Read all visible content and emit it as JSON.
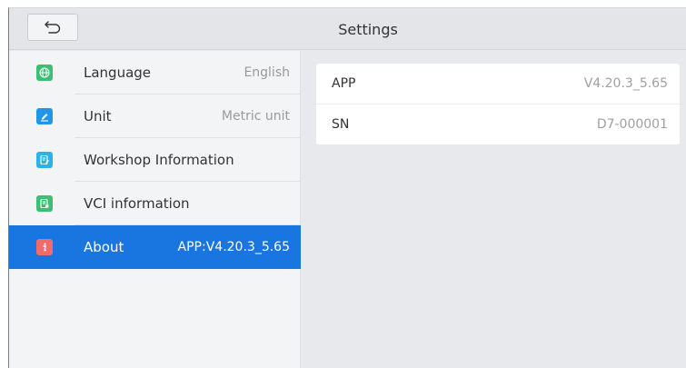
{
  "header": {
    "title": "Settings",
    "back_icon": "back-arrow-icon"
  },
  "sidebar": {
    "items": [
      {
        "label": "Language",
        "value": "English",
        "icon": "globe-icon",
        "icon_color": "#3bbf73"
      },
      {
        "label": "Unit",
        "value": "Metric unit",
        "icon": "pencil-icon",
        "icon_color": "#2196e8"
      },
      {
        "label": "Workshop Information",
        "value": "",
        "icon": "edit-document-icon",
        "icon_color": "#2bb3e8"
      },
      {
        "label": "VCI information",
        "value": "",
        "icon": "document-icon",
        "icon_color": "#3bbf73"
      },
      {
        "label": "About",
        "value": "APP:V4.20.3_5.65",
        "icon": "info-icon",
        "icon_color": "#f26b6b",
        "active": true
      }
    ]
  },
  "about": {
    "rows": [
      {
        "key": "APP",
        "value": "V4.20.3_5.65"
      },
      {
        "key": "SN",
        "value": "D7-000001"
      }
    ]
  },
  "colors": {
    "accent": "#1976e0"
  }
}
